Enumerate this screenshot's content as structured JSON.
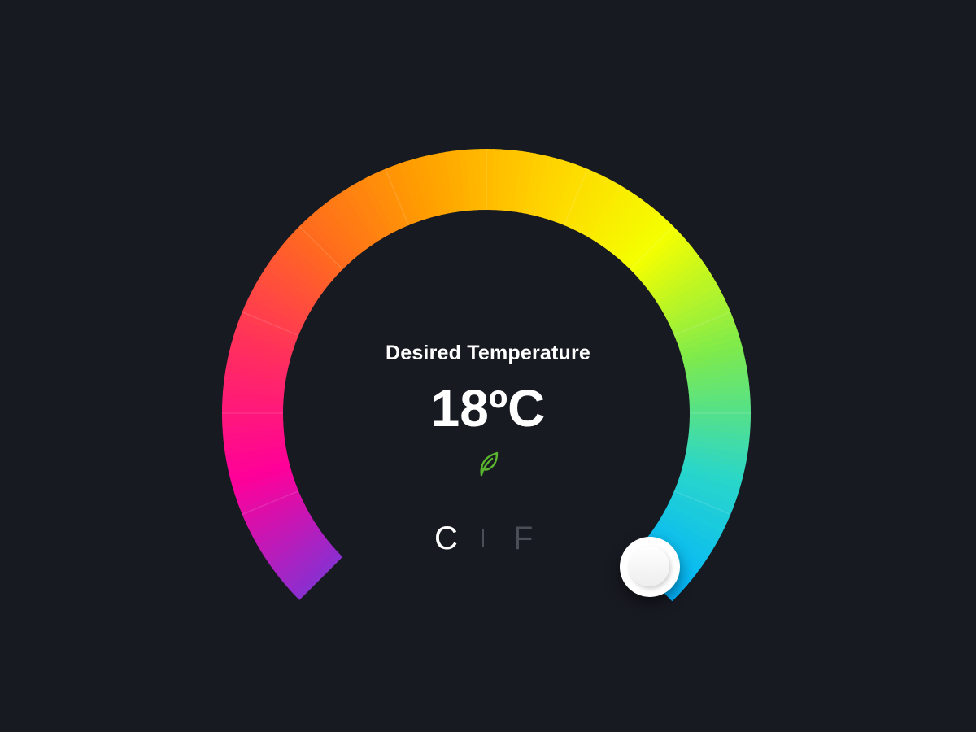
{
  "thermostat": {
    "label": "Desired Temperature",
    "value": "18ºC",
    "eco_icon": "leaf-icon",
    "units": {
      "celsius": "C",
      "fahrenheit": "F",
      "selected": "C"
    },
    "dial_colors": [
      "#8a2fd0",
      "#ff0099",
      "#ff2f5e",
      "#ff6a1e",
      "#ffa000",
      "#ffd400",
      "#f5ff00",
      "#7eea4c",
      "#2ad7c9",
      "#00b3ff"
    ],
    "accent_colors": {
      "background": "#181a22",
      "eco": "#5ab52e",
      "inactive_unit": "#4b4d57"
    }
  }
}
